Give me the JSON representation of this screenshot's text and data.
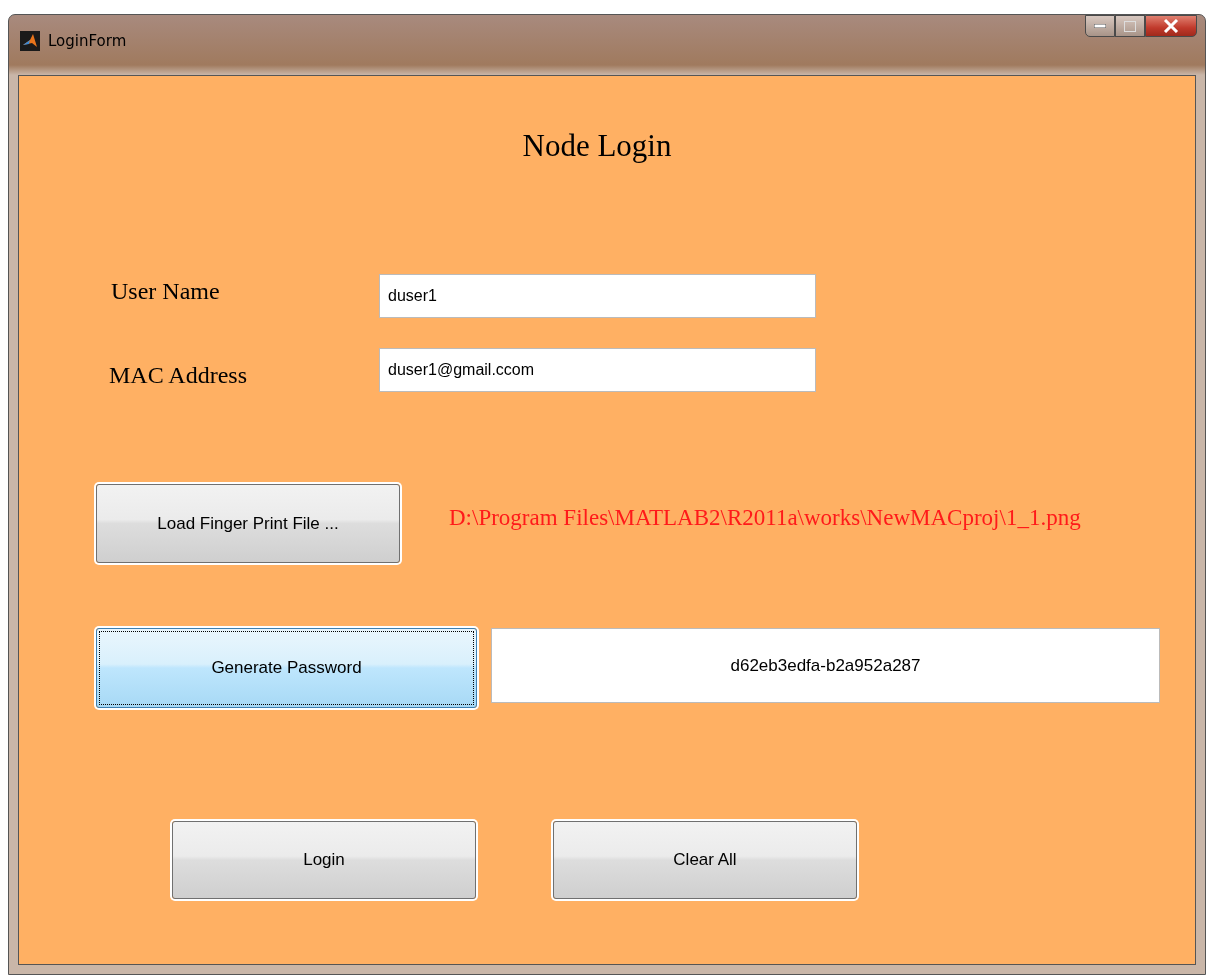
{
  "window": {
    "title": "LoginForm"
  },
  "heading": "Node Login",
  "fields": [
    {
      "label": "User Name",
      "value": "duser1"
    },
    {
      "label": "MAC Address",
      "value": "duser1@gmail.ccom"
    }
  ],
  "load_button": {
    "label": "Load Finger Print File ..."
  },
  "file_path": "D:\\Program Files\\MATLAB2\\R2011a\\works\\NewMACproj\\1_1.png",
  "generate_button": {
    "label": "Generate Password",
    "focused": true
  },
  "password": "d62eb3edfa-b2a952a287",
  "buttons": [
    {
      "label": "Login"
    },
    {
      "label": "Clear All"
    }
  ]
}
